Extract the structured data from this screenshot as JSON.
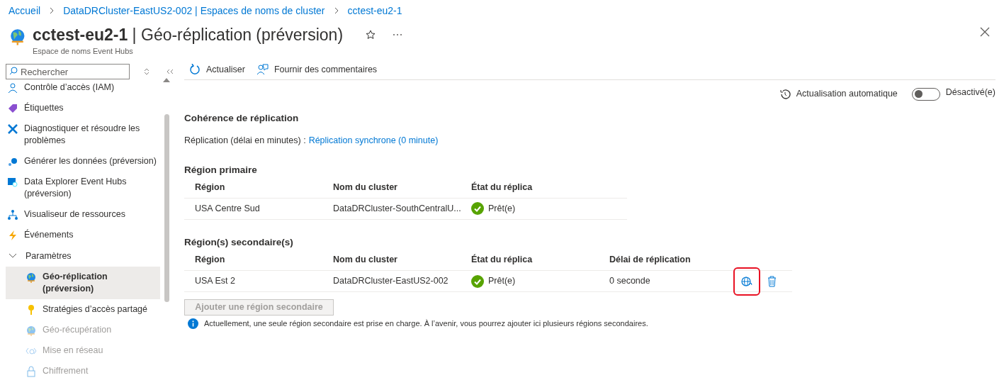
{
  "breadcrumb": [
    "Accueil",
    "DataDRCluster-EastUS2-002 | Espaces de noms de cluster",
    "cctest-eu2-1"
  ],
  "title": {
    "name": "cctest-eu2-1",
    "separator": "|",
    "page": "Géo-réplication (préversion)",
    "subtitle": "Espace de noms Event Hubs",
    "favorite": false
  },
  "sidebar": {
    "search": {
      "placeholder": "Rechercher"
    },
    "items": [
      {
        "label": "Contrôle d’accès (IAM)",
        "selected": false,
        "disabled": false
      },
      {
        "label": "Étiquettes",
        "selected": false,
        "disabled": false
      },
      {
        "label": "Diagnostiquer et résoudre les problèmes",
        "selected": false,
        "disabled": false
      },
      {
        "label": "Générer les données (préversion)",
        "selected": false,
        "disabled": false
      },
      {
        "label": "Data Explorer Event Hubs (préversion)",
        "selected": false,
        "disabled": false
      },
      {
        "label": "Visualiseur de ressources",
        "selected": false,
        "disabled": false
      },
      {
        "label": "Événements",
        "selected": false,
        "disabled": false
      },
      {
        "label": "Paramètres",
        "expanded": true,
        "children": [
          {
            "label": "Géo-réplication (préversion)",
            "selected": true,
            "disabled": false
          },
          {
            "label": "Stratégies d’accès partagé",
            "selected": false,
            "disabled": false
          },
          {
            "label": "Géo-récupération",
            "selected": false,
            "disabled": true
          },
          {
            "label": "Mise en réseau",
            "selected": false,
            "disabled": true
          },
          {
            "label": "Chiffrement",
            "selected": false,
            "disabled": true
          }
        ]
      }
    ]
  },
  "toolbar": [
    "Actualiser",
    "Fournir des commentaires"
  ],
  "auto_refresh": {
    "label": "Actualisation automatique",
    "on": false,
    "state": "Désactivé(e)"
  },
  "consistency": {
    "heading": "Cohérence de réplication",
    "label": "Réplication (délai en minutes) :",
    "link": "Réplication synchrone (0 minute)"
  },
  "primary": {
    "heading": "Région primaire",
    "columns": [
      "Région",
      "Nom du cluster",
      "État du réplica"
    ],
    "rows": [
      {
        "region": "USA Centre Sud",
        "cluster": "DataDRCluster-SouthCentralU...",
        "status": "Prêt(e)"
      }
    ]
  },
  "secondary": {
    "heading": "Région(s) secondaire(s)",
    "columns": [
      "Région",
      "Nom du cluster",
      "État du réplica",
      "Délai de réplication"
    ],
    "rows": [
      {
        "region": "USA Est 2",
        "cluster": "DataDRCluster-EastUS2-002",
        "status": "Prêt(e)",
        "delay": "0 seconde",
        "promote_highlighted": true
      }
    ],
    "add_button": {
      "label": "Ajouter une région secondaire",
      "disabled": true
    },
    "info": "Actuellement, une seule région secondaire est prise en charge. À l’avenir, vous pourrez ajouter ici plusieurs régions secondaires."
  }
}
